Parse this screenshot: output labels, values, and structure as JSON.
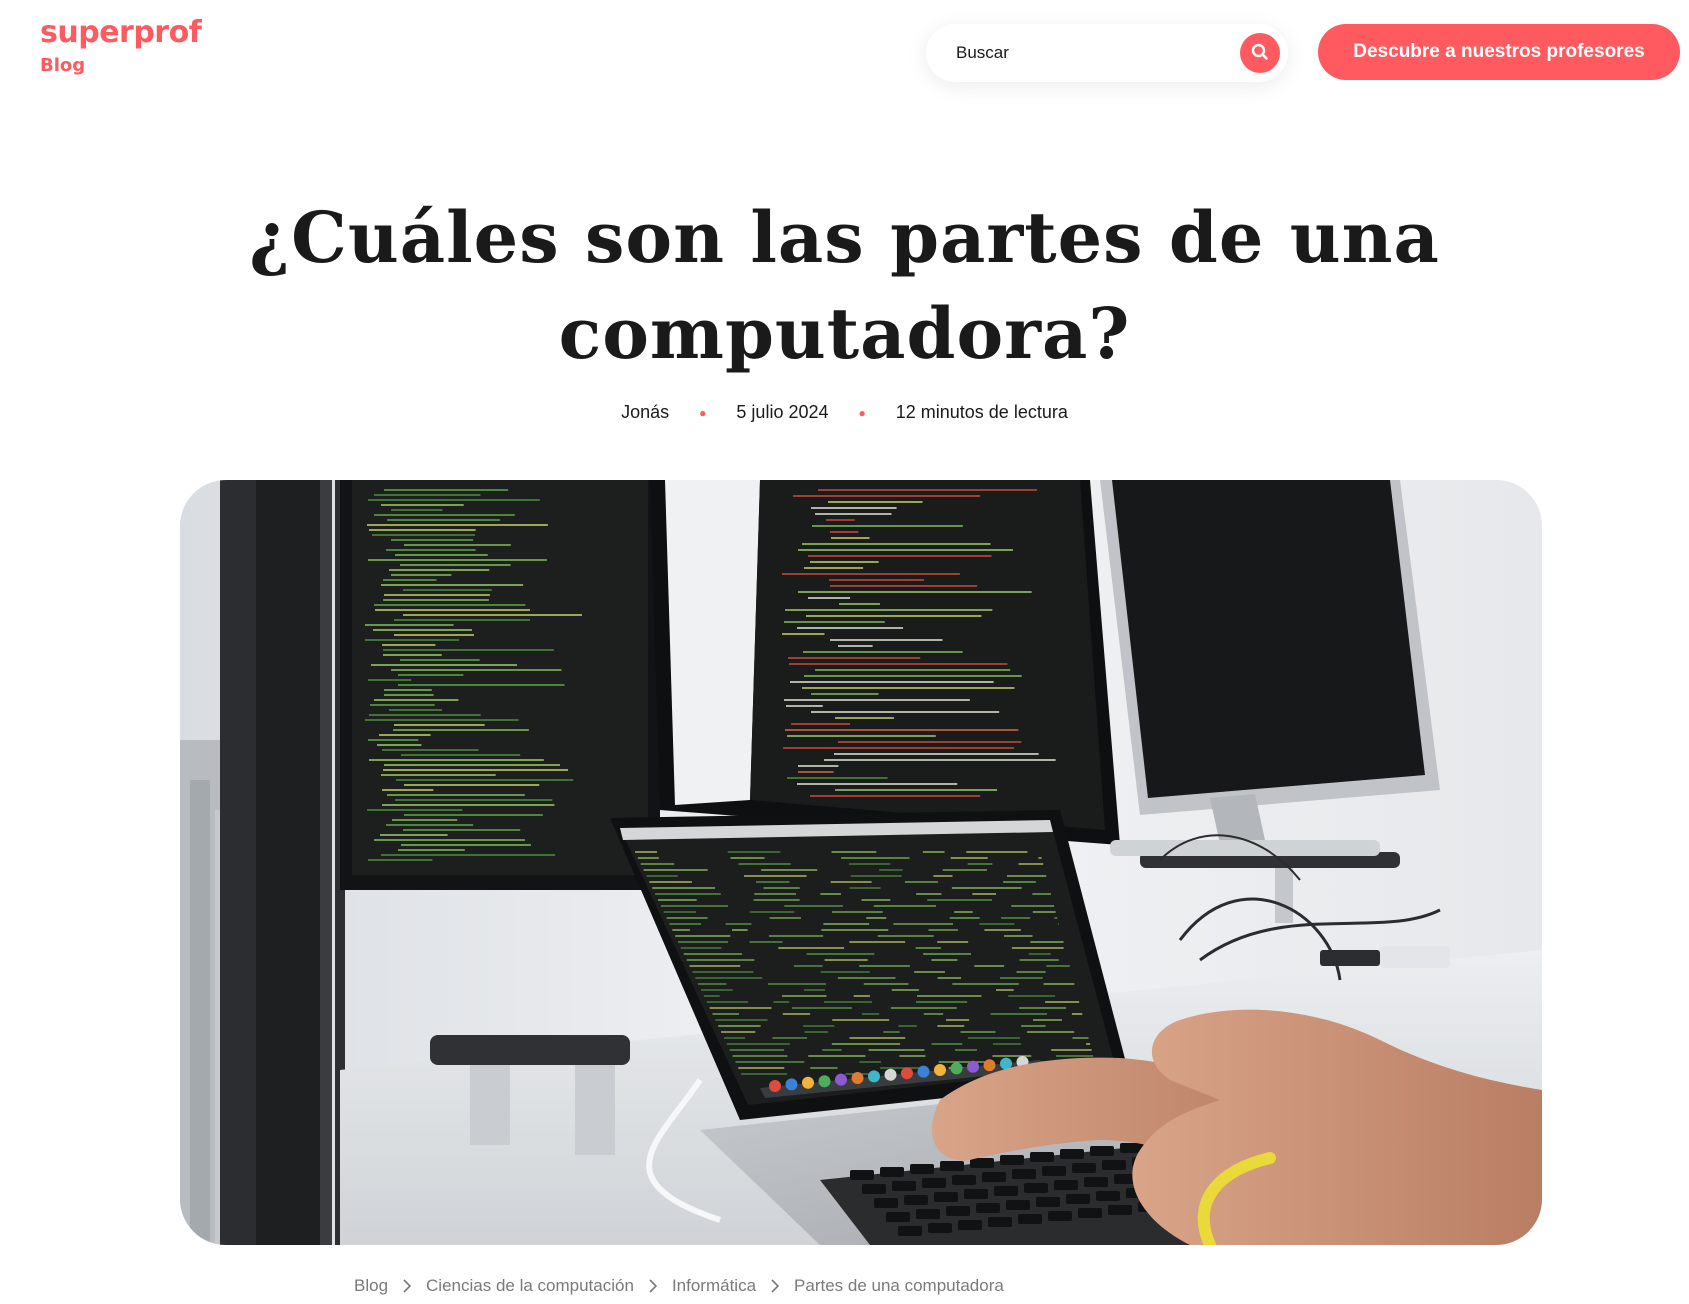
{
  "header": {
    "logo_text": "superprof",
    "logo_sub": "Blog",
    "search": {
      "placeholder": "Buscar"
    },
    "cta_label": "Descubre a nuestros profesores"
  },
  "article": {
    "title_line1": "¿Cuáles son las partes de una",
    "title_line2": "computadora?",
    "author": "Jonás",
    "date": "5 julio 2024",
    "reading_time": "12 minutos de lectura"
  },
  "breadcrumb": [
    {
      "label": "Blog"
    },
    {
      "label": "Ciencias de la computación"
    },
    {
      "label": "Informática"
    },
    {
      "label": "Partes de una computadora"
    }
  ],
  "colors": {
    "brand": "#ff5a5f",
    "text": "#1a1a1a",
    "muted": "#7a7a7a"
  },
  "icons": {
    "search": "magnifier-icon",
    "breadcrumb_separator": "chevron-right-icon",
    "meta_separator": "dot"
  }
}
